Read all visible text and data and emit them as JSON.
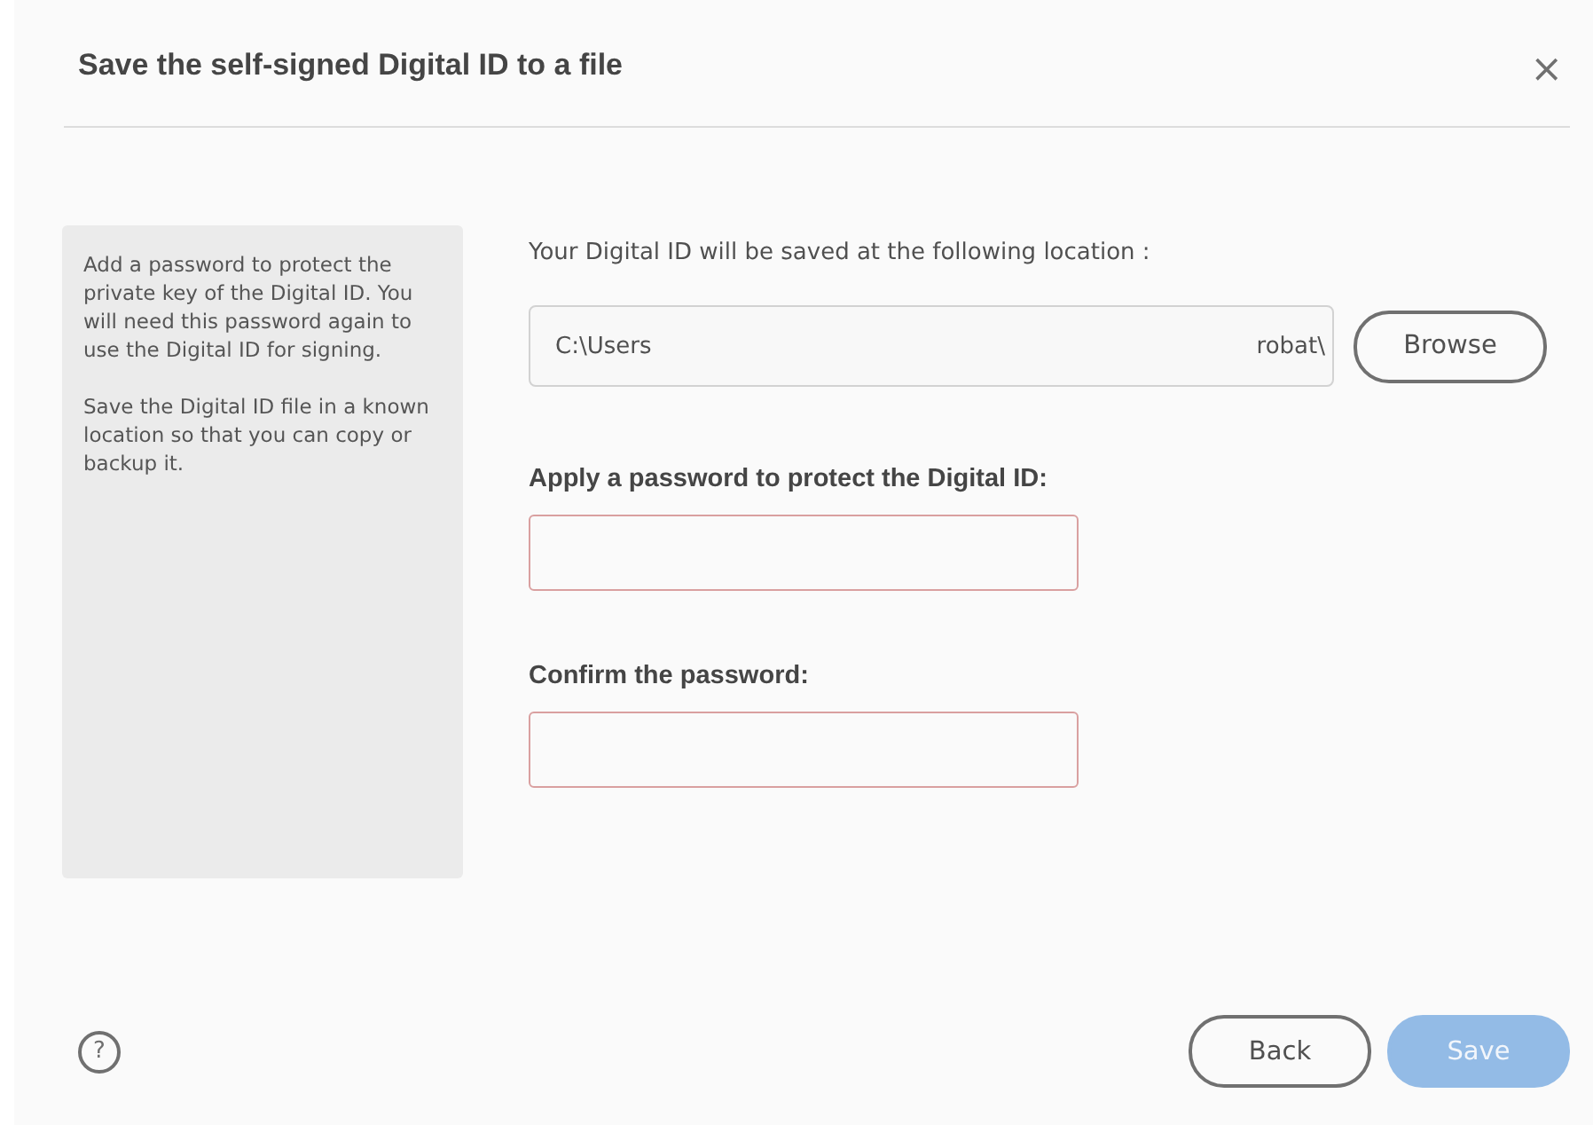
{
  "dialog": {
    "title": "Save the self-signed Digital ID to a file",
    "close": "×"
  },
  "info_panel": {
    "paragraphs": [
      "Add a password to protect the private key of the Digital ID. You will need this password again to use the Digital ID for signing.",
      "Save the Digital ID file in a known location so that you can copy or backup it."
    ]
  },
  "location": {
    "label": "Your Digital ID will be saved at the following location :",
    "value_start": "C:\\Users",
    "value_end": "robat\\",
    "browse_button": "Browse"
  },
  "fields": [
    {
      "label": "Apply a password to protect the Digital ID:",
      "invalid": true
    },
    {
      "label": "Confirm the password:",
      "invalid": true
    }
  ],
  "footer": {
    "help": "?",
    "buttons": [
      {
        "label": "Back",
        "kind": "secondary",
        "disabled": false
      },
      {
        "label": "Save",
        "kind": "primary",
        "disabled": true
      }
    ]
  }
}
